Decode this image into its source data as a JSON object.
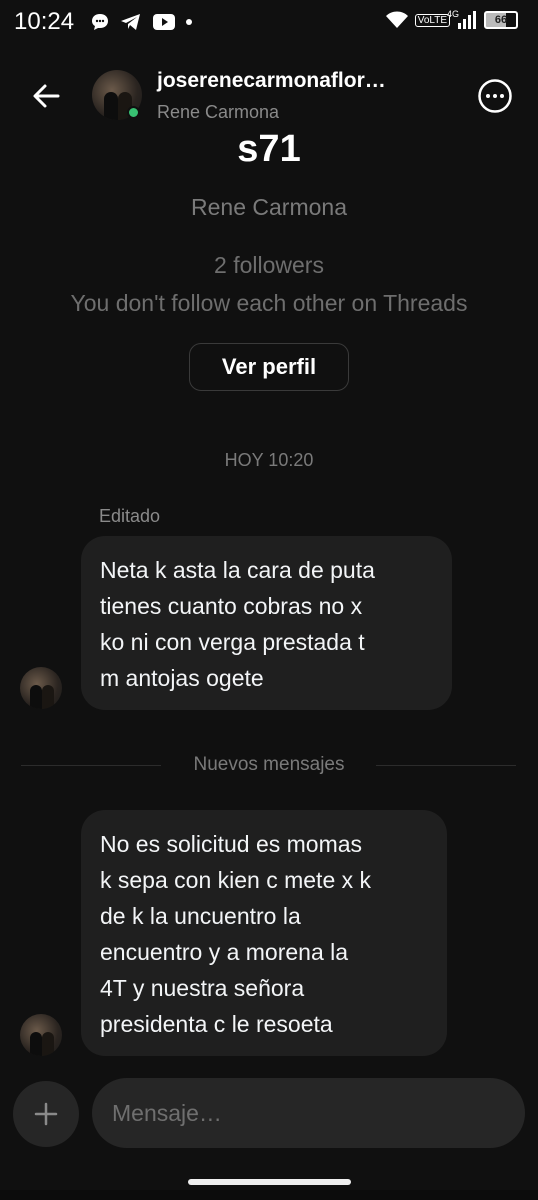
{
  "status_bar": {
    "time": "10:24",
    "network_label": "VoLTE",
    "network_gen": "4G",
    "battery": "66"
  },
  "header": {
    "username": "joserenecarmonaflor…",
    "subtitle": "Rene Carmona"
  },
  "profile": {
    "name": "s71",
    "full_name": "Rene Carmona",
    "followers": "2 followers",
    "mutual": "You don't follow each other on Threads",
    "view_profile_label": "Ver perfil"
  },
  "conversation": {
    "timestamp": "HOY 10:20",
    "edited_label": "Editado",
    "new_messages_label": "Nuevos mensajes",
    "messages": [
      {
        "text": "Neta k asta la cara de puta\ntienes cuanto cobras no x\nko ni con verga prestada t\nm antojas ogete"
      },
      {
        "text": "No es solicitud es momas\nk sepa con kien c mete x k\nde k la uncuentro la\nencuentro  y a morena  la\n4T  y nuestra señora\npresidenta c le resoeta"
      }
    ]
  },
  "composer": {
    "placeholder": "Mensaje…"
  },
  "colors": {
    "background": "#101010",
    "bubble": "#1f1f1f",
    "online": "#38c172",
    "muted_text": "#7a7a7a"
  }
}
